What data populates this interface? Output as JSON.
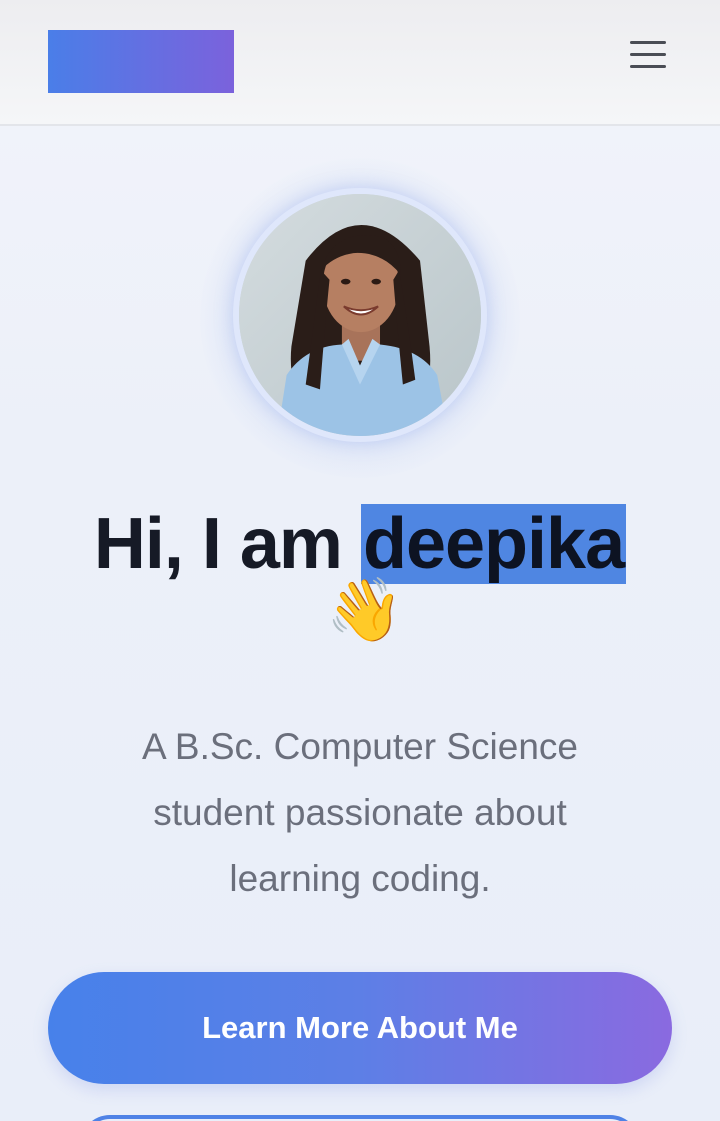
{
  "header": {
    "logo": "brand-logo-gradient",
    "menu_icon": "hamburger-menu-icon"
  },
  "hero": {
    "avatar_alt": "profile-photo",
    "greeting": "Hi, I am ",
    "name": "deepika",
    "wave_emoji": "👋",
    "subtitle": "A B.Sc. Computer Science student passionate about learning coding."
  },
  "actions": {
    "primary_label": "Learn More About Me"
  },
  "colors": {
    "accent_start": "#4781ea",
    "accent_end": "#8a6ae0",
    "highlight": "#4f86e2",
    "text_dark": "#161a26",
    "text_muted": "#6b6f7c"
  }
}
